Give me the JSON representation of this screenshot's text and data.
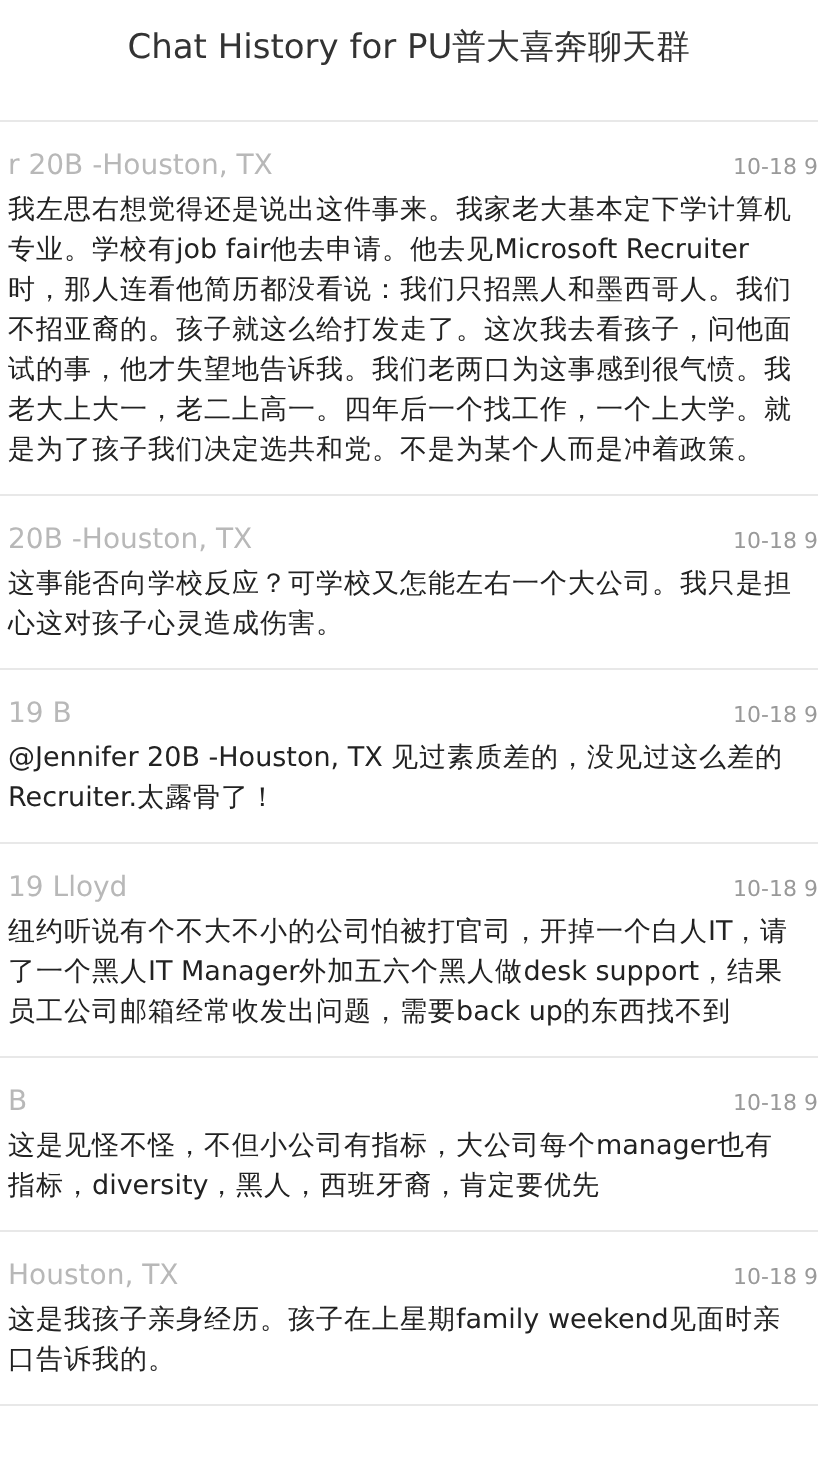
{
  "title": "Chat History for PU普大喜奔聊天群",
  "messages": [
    {
      "sender": "r 20B -Houston, TX",
      "time": "10-18 9",
      "text": "我左思右想觉得还是说出这件事来。我家老大基本定下学计算机专业。学校有job fair他去申请。他去见Microsoft Recruiter时，那人连看他简历都没看说：我们只招黑人和墨西哥人。我们不招亚裔的。孩子就这么给打发走了。这次我去看孩子，问他面试的事，他才失望地告诉我。我们老两口为这事感到很气愤。我老大上大一，老二上高一。四年后一个找工作，一个上大学。就是为了孩子我们决定选共和党。不是为某个人而是冲着政策。"
    },
    {
      "sender": "20B -Houston, TX",
      "time": "10-18 9",
      "text": "这事能否向学校反应？可学校又怎能左右一个大公司。我只是担心这对孩子心灵造成伤害。"
    },
    {
      "sender": "19 B",
      "time": "10-18 9",
      "text": "@Jennifer 20B -Houston, TX 见过素质差的，没见过这么差的Recruiter.太露骨了！"
    },
    {
      "sender": "19 Lloyd",
      "time": "10-18 9",
      "text": "纽约听说有个不大不小的公司怕被打官司，开掉一个白人IT，请了一个黑人IT Manager外加五六个黑人做desk support，结果员工公司邮箱经常收发出问题，需要back up的东西找不到"
    },
    {
      "sender": "B",
      "time": "10-18 9",
      "text": "这是见怪不怪，不但小公司有指标，大公司每个manager也有指标，diversity，黑人，西班牙裔，肯定要优先"
    },
    {
      "sender": "Houston, TX",
      "time": "10-18 9",
      "text": "这是我孩子亲身经历。孩子在上星期family weekend见面时亲口告诉我的。"
    }
  ]
}
